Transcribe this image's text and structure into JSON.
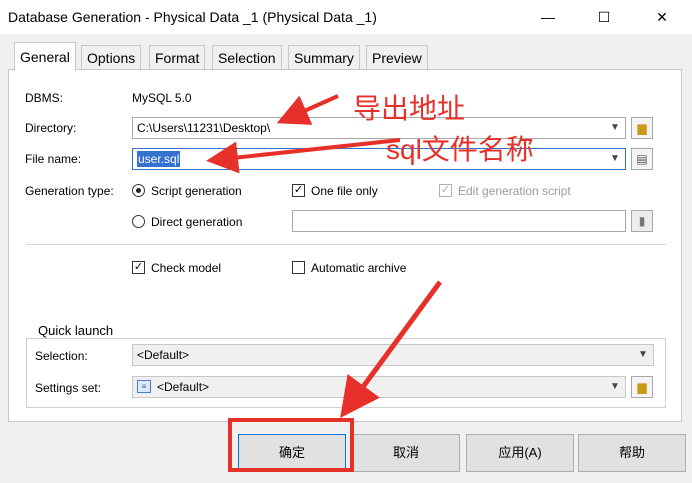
{
  "window": {
    "title": "Database Generation - Physical Data _1 (Physical Data _1)",
    "minimize_glyph": "—",
    "maximize_glyph": "☐",
    "close_glyph": "✕"
  },
  "tabs": [
    {
      "label": "General",
      "active": true
    },
    {
      "label": "Options",
      "active": false
    },
    {
      "label": "Format",
      "active": false
    },
    {
      "label": "Selection",
      "active": false
    },
    {
      "label": "Summary",
      "active": false
    },
    {
      "label": "Preview",
      "active": false
    }
  ],
  "general": {
    "dbms_label": "DBMS:",
    "dbms_value": "MySQL 5.0",
    "directory_label": "Directory:",
    "directory_value": "C:\\Users\\11231\\Desktop\\",
    "filename_label": "File name:",
    "filename_value": "user.sql",
    "generation_type_label": "Generation type:",
    "script_generation": "Script generation",
    "direct_generation": "Direct generation",
    "one_file_only": "One file only",
    "edit_generation_script": "Edit generation script",
    "check_model": "Check model",
    "automatic_archive": "Automatic archive"
  },
  "quick_launch": {
    "legend": "Quick launch",
    "selection_label": "Selection:",
    "selection_value": "<Default>",
    "settings_label": "Settings set:",
    "settings_value": "<Default>"
  },
  "buttons": {
    "ok": "确定",
    "cancel": "取消",
    "apply": "应用(A)",
    "help": "帮助"
  },
  "annotations": {
    "export_address": "导出地址",
    "sql_filename": "sql文件名称"
  },
  "colors": {
    "annotation_red": "#e8302a",
    "selection_blue": "#3372cf",
    "focus_border": "#2f72c9"
  }
}
